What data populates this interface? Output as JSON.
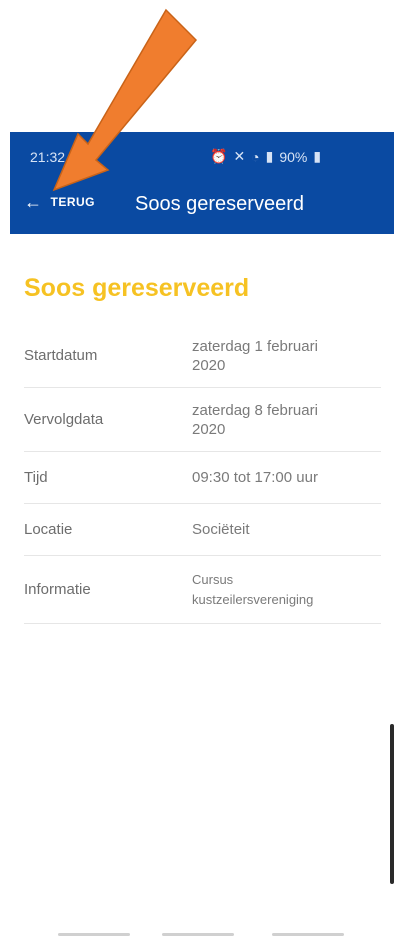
{
  "statusbar": {
    "time": "21:32",
    "battery": "90%"
  },
  "appbar": {
    "back_label": "TERUG",
    "title": "Soos gereserveerd"
  },
  "page": {
    "heading": "Soos gereserveerd",
    "rows": [
      {
        "label": "Startdatum",
        "value_line1": "zaterdag 1 februari",
        "value_line2": "2020"
      },
      {
        "label": "Vervolgdata",
        "value_line1": "zaterdag 8 februari",
        "value_line2": "2020"
      },
      {
        "label": "Tijd",
        "value_line1": "09:30 tot 17:00 uur",
        "value_line2": ""
      },
      {
        "label": "Locatie",
        "value_line1": "Sociëteit",
        "value_line2": ""
      },
      {
        "label": "Informatie",
        "value_line1": "Cursus",
        "value_line2": "kustzeilersvereniging"
      }
    ]
  },
  "colors": {
    "appbar": "#0a4aa2",
    "heading": "#f6c223",
    "annotation_arrow": "#f07d2e"
  }
}
